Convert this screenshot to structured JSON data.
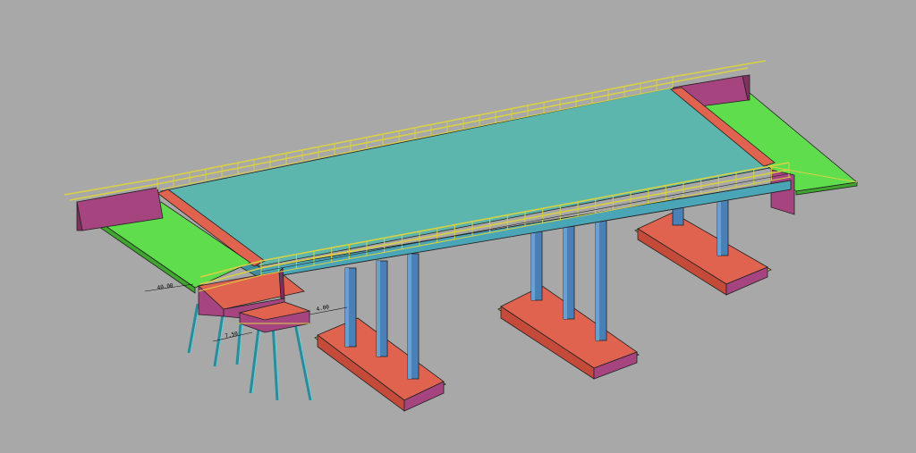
{
  "scene": {
    "background": "#a8a8a8",
    "colors": {
      "deck_top": "#5cb6ad",
      "deck_edge": "#4aa6b6",
      "deck_underside": "#3f8d9c",
      "approach_slab": "#5fdd4c",
      "abutment": "#a6447f",
      "abutment_dark": "#80305f",
      "pier_cap": "#e0634f",
      "pier_cap_side": "#c44a3a",
      "footing_side": "#a6447f",
      "footing_top": "#e0634f",
      "column": "#4a80b8",
      "column_dark": "#3a6aa0",
      "railing": "#d9d144",
      "pile": "#4ab2bf",
      "outline": "#222222"
    }
  },
  "annotations": {
    "dim_1": "40.00",
    "dim_2": "7.50",
    "dim_3": "4.00"
  }
}
